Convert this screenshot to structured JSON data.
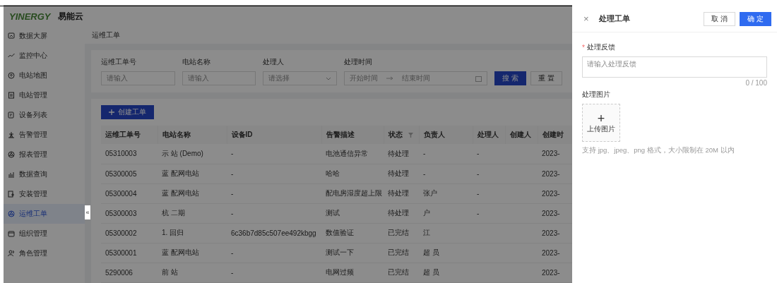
{
  "header": {
    "logo": "YINERGY",
    "brand": "易能云"
  },
  "sidebar": {
    "items": [
      {
        "label": "数据大屏",
        "selected": false
      },
      {
        "label": "监控中心",
        "selected": false
      },
      {
        "label": "电站地图",
        "selected": false
      },
      {
        "label": "电站管理",
        "selected": false
      },
      {
        "label": "设备列表",
        "selected": false
      },
      {
        "label": "告警管理",
        "selected": false
      },
      {
        "label": "报表管理",
        "selected": false
      },
      {
        "label": "数据查询",
        "selected": false
      },
      {
        "label": "安装管理",
        "selected": false
      },
      {
        "label": "运维工单",
        "selected": true
      },
      {
        "label": "组织管理",
        "selected": false
      },
      {
        "label": "角色管理",
        "selected": false
      }
    ],
    "collapse": "«"
  },
  "breadcrumb": "运维工单",
  "filters": {
    "fields": [
      {
        "kind": "input",
        "label": "运维工单号",
        "placeholder": "请输入"
      },
      {
        "kind": "input",
        "label": "电站名称",
        "placeholder": "请输入"
      },
      {
        "kind": "select",
        "label": "处理人",
        "placeholder": "请选择"
      },
      {
        "kind": "range",
        "label": "处理时间",
        "placeholder": "开始时间",
        "placeholder_end": "结束时间"
      }
    ],
    "buttons": [
      {
        "label": "搜 索",
        "primary": true
      },
      {
        "label": "重 置",
        "primary": false
      }
    ]
  },
  "create_button": "创建工单",
  "table": {
    "columns": [
      "运维工单号",
      "电站名称",
      "设备ID",
      "告警描述",
      "状态",
      "负责人",
      "处理人",
      "创建人",
      "创建时"
    ],
    "rows": [
      [
        "05310003",
        "示 站 (Demo)",
        "-",
        "电池通信异常",
        "待处理",
        "-",
        "-",
        "",
        "2023-"
      ],
      [
        "05300005",
        "蓝 配网电站",
        "-",
        "哈哈",
        "待处理",
        "-",
        "-",
        "",
        "2023-"
      ],
      [
        "05300004",
        "蓝 配网电站",
        "-",
        "配电房湿度超上限",
        "待处理",
        "张户",
        "-",
        "",
        "2023-"
      ],
      [
        "05300003",
        "杭 二期",
        "-",
        "测试",
        "待处理",
        "户",
        "-",
        "",
        "2023-"
      ],
      [
        "05300002",
        "1. 回归",
        "6c36b7d85c507ee492kbgg",
        "数值验证",
        "已完结",
        "江",
        "",
        "",
        "2023-"
      ],
      [
        "05300001",
        "蓝 配网电站",
        "-",
        "测试一下",
        "已完结",
        "超 员",
        "",
        "",
        "2023-"
      ],
      [
        "5290006",
        "前 站",
        "-",
        "电网过频",
        "已完结",
        "超 员",
        "",
        "",
        "2023-"
      ]
    ]
  },
  "drawer": {
    "close": "×",
    "title": "处理工单",
    "cancel": "取 消",
    "confirm": "确 定",
    "feedback_label": "处理反馈",
    "required_mark": "*",
    "feedback_placeholder": "请输入处理反馈",
    "counter": "0 / 100",
    "image_label": "处理图片",
    "upload_plus": "+",
    "upload_label": "上传图片",
    "hint": "支持 jpg、jpeg、png 格式，大小限制在 20M 以内"
  }
}
